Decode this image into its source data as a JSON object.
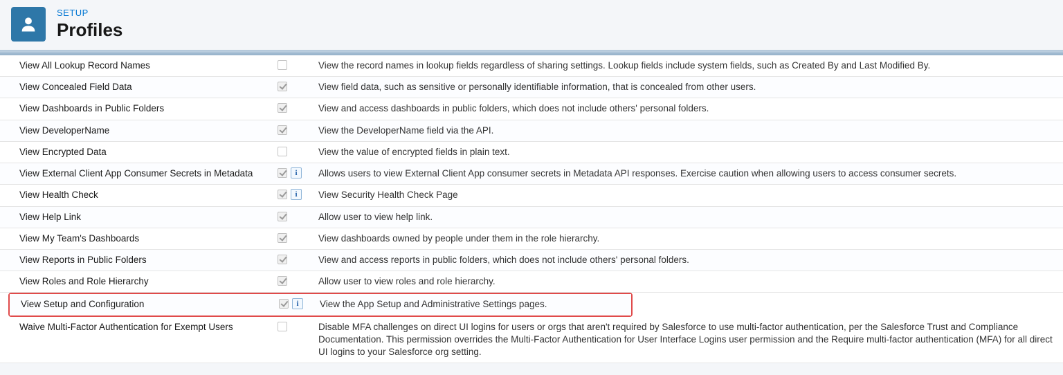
{
  "header": {
    "setup_label": "SETUP",
    "page_title": "Profiles"
  },
  "permissions": [
    {
      "name": "View All Lookup Record Names",
      "checked": false,
      "has_info": false,
      "description": "View the record names in lookup fields regardless of sharing settings. Lookup fields include system fields, such as Created By and Last Modified By."
    },
    {
      "name": "View Concealed Field Data",
      "checked": true,
      "has_info": false,
      "description": "View field data, such as sensitive or personally identifiable information, that is concealed from other users."
    },
    {
      "name": "View Dashboards in Public Folders",
      "checked": true,
      "has_info": false,
      "description": "View and access dashboards in public folders, which does not include others' personal folders."
    },
    {
      "name": "View DeveloperName",
      "checked": true,
      "has_info": false,
      "description": "View the DeveloperName field via the API."
    },
    {
      "name": "View Encrypted Data",
      "checked": false,
      "has_info": false,
      "description": "View the value of encrypted fields in plain text."
    },
    {
      "name": "View External Client App Consumer Secrets in Metadata",
      "checked": true,
      "has_info": true,
      "description": "Allows users to view External Client App consumer secrets in Metadata API responses. Exercise caution when allowing users to access consumer secrets."
    },
    {
      "name": "View Health Check",
      "checked": true,
      "has_info": true,
      "description": "View Security Health Check Page"
    },
    {
      "name": "View Help Link",
      "checked": true,
      "has_info": false,
      "description": "Allow user to view help link."
    },
    {
      "name": "View My Team's Dashboards",
      "checked": true,
      "has_info": false,
      "description": "View dashboards owned by people under them in the role hierarchy."
    },
    {
      "name": "View Reports in Public Folders",
      "checked": true,
      "has_info": false,
      "description": "View and access reports in public folders, which does not include others' personal folders."
    },
    {
      "name": "View Roles and Role Hierarchy",
      "checked": true,
      "has_info": false,
      "description": "Allow user to view roles and role hierarchy."
    },
    {
      "name": "View Setup and Configuration",
      "checked": true,
      "has_info": true,
      "description": "View the App Setup and Administrative Settings pages.",
      "highlighted": true
    },
    {
      "name": "Waive Multi-Factor Authentication for Exempt Users",
      "checked": false,
      "has_info": false,
      "description": "Disable MFA challenges on direct UI logins for users or orgs that aren't required by Salesforce to use multi-factor authentication, per the Salesforce Trust and Compliance Documentation. This permission overrides the Multi-Factor Authentication for User Interface Logins user permission and the Require multi-factor authentication (MFA) for all direct UI logins to your Salesforce org setting."
    }
  ]
}
